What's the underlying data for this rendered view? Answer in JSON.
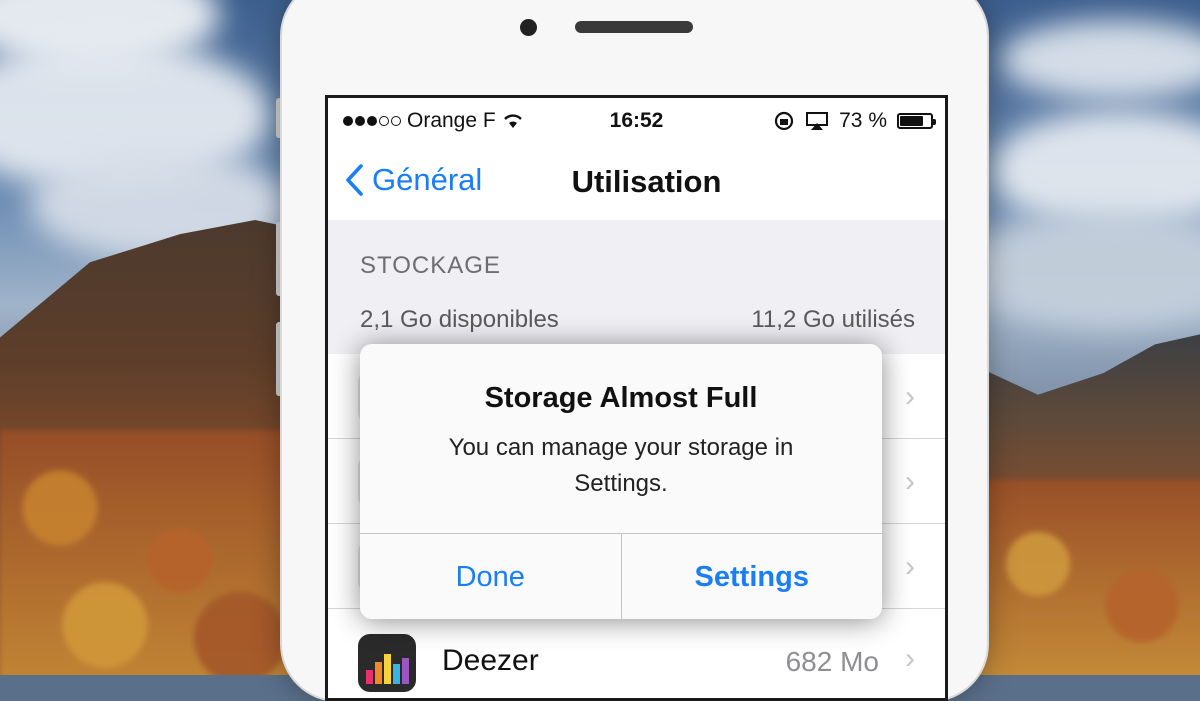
{
  "status_bar": {
    "carrier": "Orange F",
    "time": "16:52",
    "battery": "73 %",
    "battery_level": 0.73,
    "signal_bars_filled": 3,
    "signal_bars_total": 5
  },
  "nav": {
    "back_label": "Général",
    "title": "Utilisation"
  },
  "storage": {
    "section_header": "STOCKAGE",
    "available": "2,1 Go disponibles",
    "used": "11,2 Go utilisés"
  },
  "app_list": [
    {
      "name": "Deezer",
      "size": "682 Mo"
    }
  ],
  "alert": {
    "title": "Storage Almost Full",
    "message": "You can manage your storage in Settings.",
    "buttons": [
      "Done",
      "Settings"
    ]
  },
  "colors": {
    "accent": "#1a7ef7",
    "section_bg": "#efeff4"
  }
}
